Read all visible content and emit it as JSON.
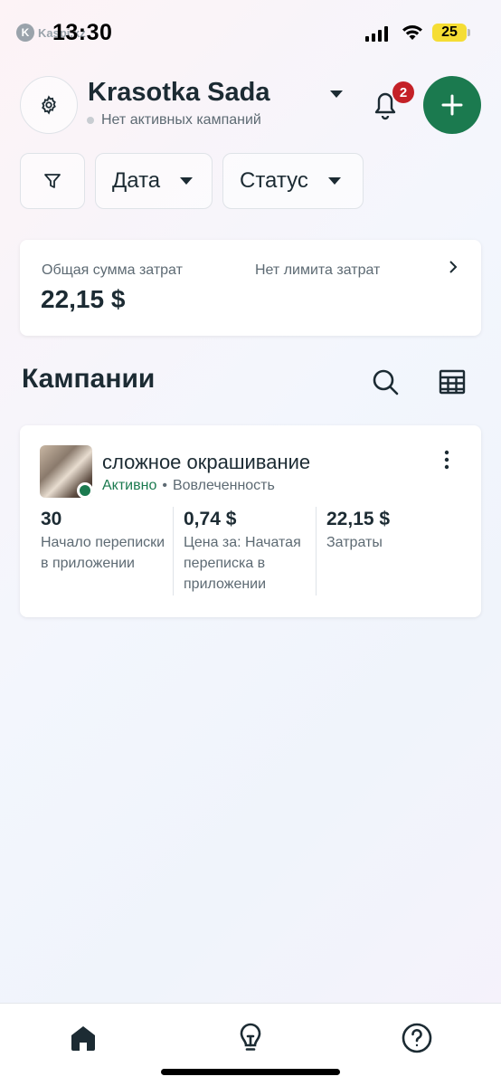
{
  "status_bar": {
    "carrier": "Kaspi.kz",
    "time": "13:30",
    "battery": "25"
  },
  "header": {
    "account_name": "Krasotka Sada",
    "account_status": "Нет активных кампаний",
    "notifications_count": "2",
    "icons": [
      "gear-icon",
      "chevron-down-icon",
      "bell-icon",
      "plus-icon"
    ]
  },
  "filters": {
    "date_label": "Дата",
    "status_label": "Статус"
  },
  "spend": {
    "label": "Общая сумма затрат",
    "value": "22,15 $",
    "limit_label": "Нет лимита затрат"
  },
  "campaigns": {
    "title": "Кампании",
    "items": [
      {
        "name": "сложное окрашивание",
        "status": "Активно",
        "separator": "•",
        "objective": "Вовлеченность",
        "metrics": [
          {
            "value": "30",
            "label": "Начало переписки в приложении"
          },
          {
            "value": "0,74 $",
            "label": "Цена за: Начатая переписка в приложении"
          },
          {
            "value": "22,15 $",
            "label": "Затраты"
          }
        ]
      }
    ]
  },
  "bottom_nav": {
    "items": [
      "home-icon",
      "lightbulb-icon",
      "help-icon"
    ]
  },
  "colors": {
    "brand_green": "#1b7a4f",
    "badge_red": "#c42127",
    "text_primary": "#1c2b33",
    "text_secondary": "#5d6a73"
  }
}
